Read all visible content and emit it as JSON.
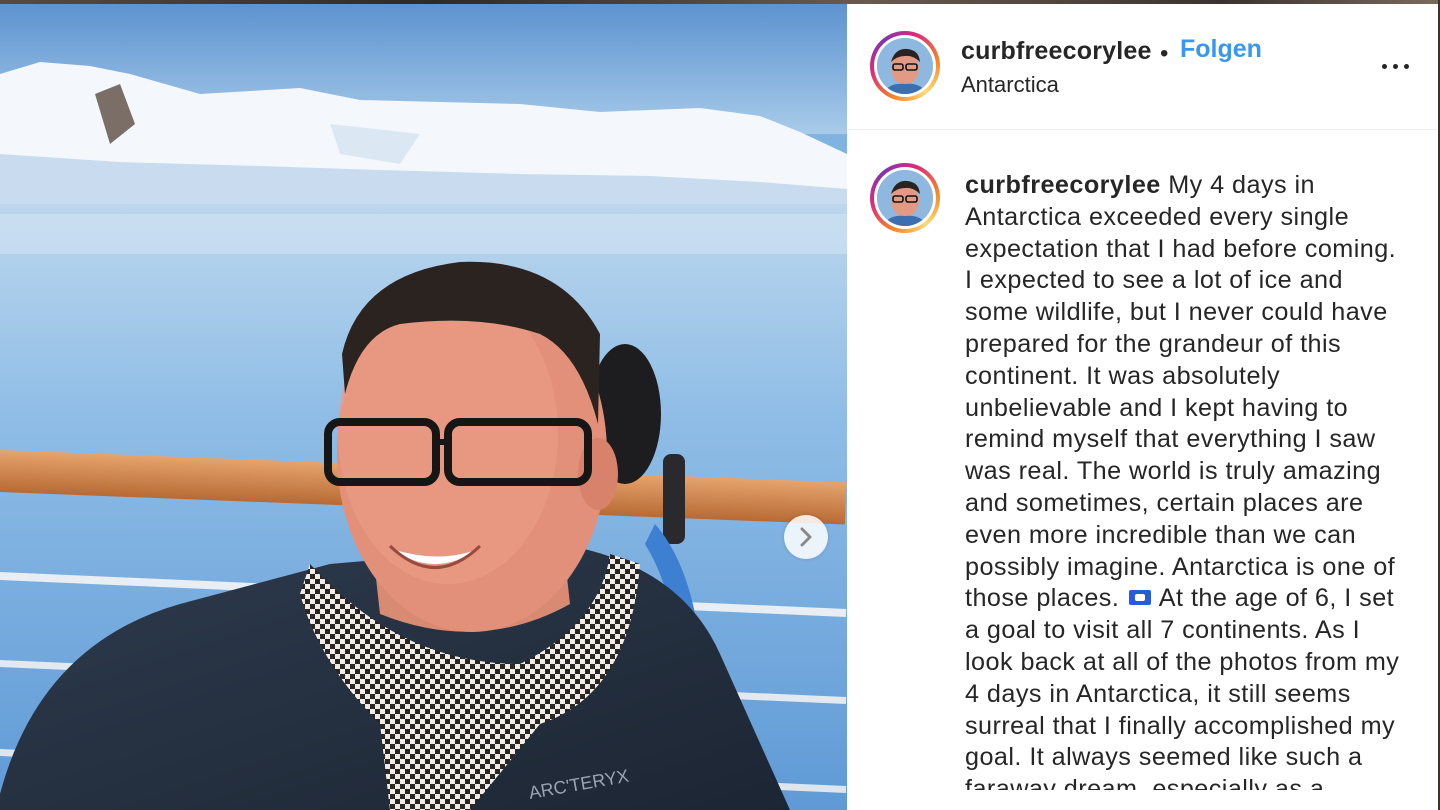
{
  "post": {
    "username": "curbfreecorylee",
    "separator": "•",
    "follow_label": "Folgen",
    "location": "Antarctica",
    "more_icon": "more-horizontal-icon",
    "caption_username": "curbfreecorylee",
    "caption_part1": "My 4 days in Antarctica exceeded every single expectation that I had before coming. I expected to see a lot of ice and some wildlife, but I never could have prepared for the grandeur of this continent. It was absolutely unbelievable and I kept having to remind myself that everything I saw was real. The world is truly amazing and sometimes, certain places are even more incredible than we can possibly imagine. Antarctica is one of those places.",
    "caption_emoji": "flag-icon",
    "caption_part2": "At the age of 6, I set a goal to visit all 7 continents. As I look back at all of the photos from my 4 days in Antarctica, it still seems surreal that I finally accomplished my goal. It always seemed like such a faraway dream, especially as a"
  },
  "photo": {
    "next_icon": "chevron-right-icon",
    "jacket_logo_text": "ARC'TERYX"
  },
  "colors": {
    "follow_blue": "#3897f0",
    "text": "#262626",
    "panel_bg": "#ffffff",
    "sky": "#7fb3e0"
  }
}
